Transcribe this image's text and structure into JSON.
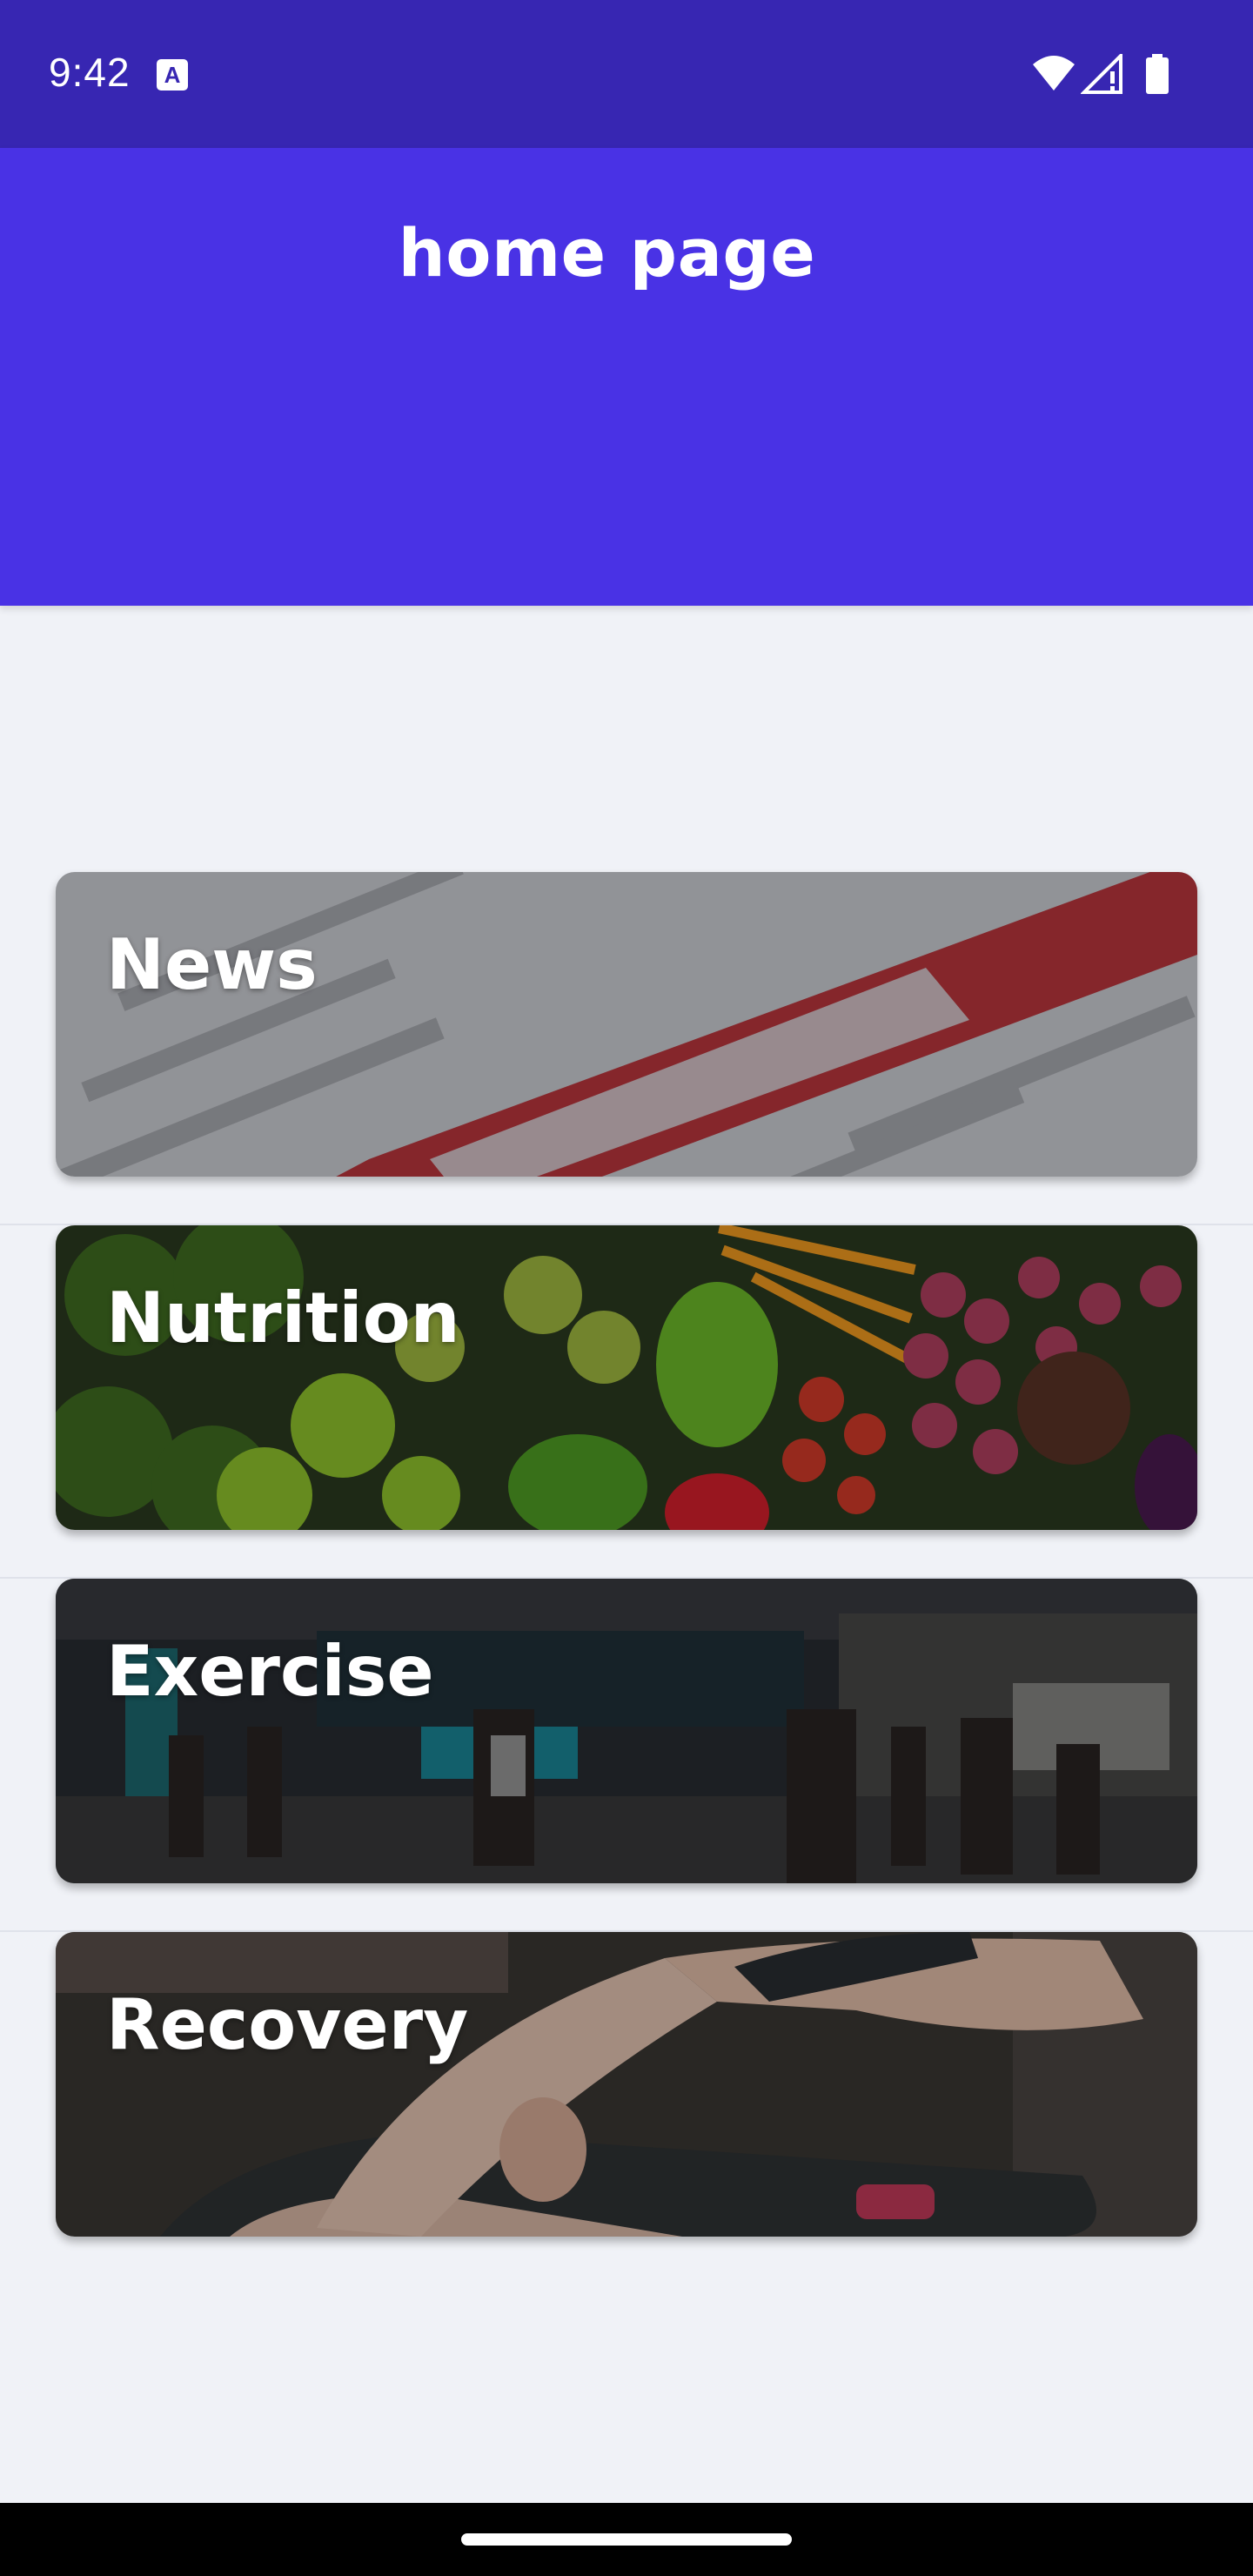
{
  "status_bar": {
    "time": "9:42",
    "notification_icon": "text-a-icon",
    "icons": [
      "wifi-icon",
      "cell-signal-icon",
      "battery-icon"
    ]
  },
  "header": {
    "title": "home page",
    "color": "#4932e5"
  },
  "cards": [
    {
      "label": "News",
      "image": "sport-newspaper-word-cloud"
    },
    {
      "label": "Nutrition",
      "image": "fruits-and-vegetables"
    },
    {
      "label": "Exercise",
      "image": "crossfit-gym"
    },
    {
      "label": "Recovery",
      "image": "person-stretching-leg"
    }
  ],
  "colors": {
    "status_bar": "#3726b2",
    "background": "#f0f2f7"
  }
}
